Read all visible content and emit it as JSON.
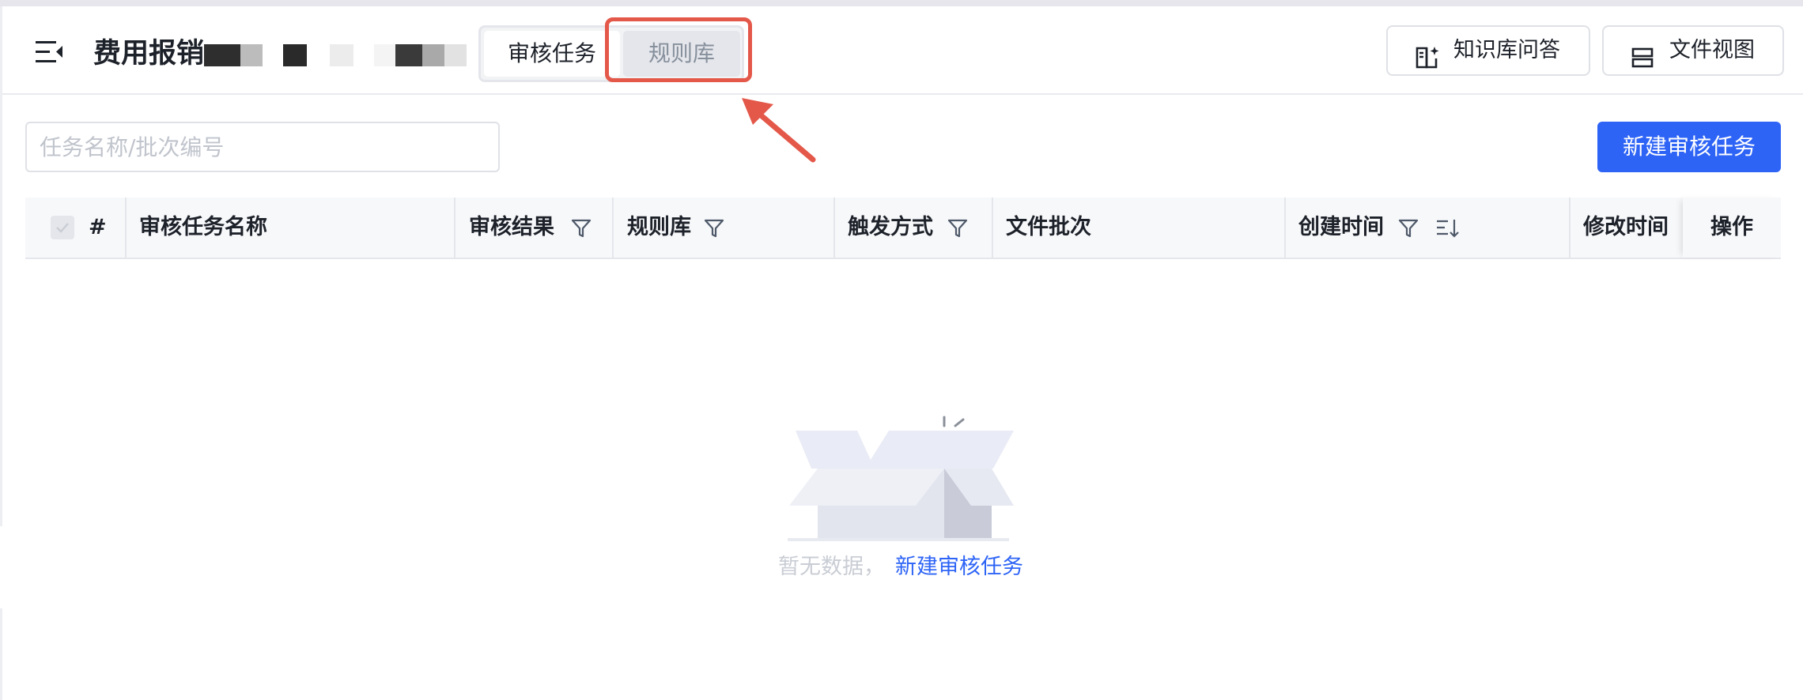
{
  "header": {
    "title": "费用报销",
    "tabs": [
      {
        "label": "审核任务",
        "active": true
      },
      {
        "label": "规则库",
        "active": false
      }
    ],
    "knowledge_button": "知识库问答",
    "file_view_button": "文件视图"
  },
  "toolbar": {
    "search_placeholder": "任务名称/批次编号",
    "new_task_button": "新建审核任务"
  },
  "table": {
    "columns": [
      "#",
      "审核任务名称",
      "审核结果",
      "规则库",
      "触发方式",
      "文件批次",
      "创建时间",
      "修改时间",
      "操作"
    ]
  },
  "empty_state": {
    "text": "暂无数据，",
    "link": "新建审核任务"
  },
  "colors": {
    "primary": "#2e64f6",
    "highlight": "#e4584a"
  }
}
